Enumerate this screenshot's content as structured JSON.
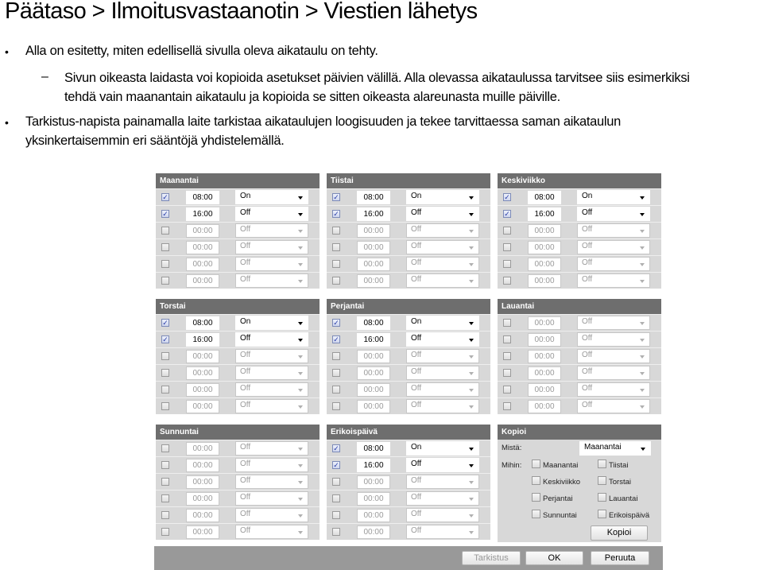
{
  "title": "Päätaso > Ilmoitusvastaanotin > Viestien lähetys",
  "bullets": [
    "Alla on esitetty, miten edellisellä sivulla oleva aikataulu on tehty.",
    "Sivun oikeasta laidasta voi kopioida asetukset päivien välillä. Alla olevassa aikataulussa tarvitsee siis esimerkiksi",
    "tehdä vain maanantain aikataulu ja kopioida se sitten oikeasta alareunasta muille päiville.",
    "Tarkistus-napista painamalla laite tarkistaa aikataulujen loogisuuden ja tekee tarvittaessa saman aikataulun",
    "yksinkertaisemmin eri sääntöjä yhdistelemällä."
  ],
  "panels": [
    {
      "name": "Maanantai",
      "rows": [
        {
          "checked": true,
          "time": "08:00",
          "state": "On"
        },
        {
          "checked": true,
          "time": "16:00",
          "state": "Off"
        },
        {
          "checked": false,
          "time": "00:00",
          "state": "Off"
        },
        {
          "checked": false,
          "time": "00:00",
          "state": "Off"
        },
        {
          "checked": false,
          "time": "00:00",
          "state": "Off"
        },
        {
          "checked": false,
          "time": "00:00",
          "state": "Off"
        }
      ]
    },
    {
      "name": "Tiistai",
      "rows": [
        {
          "checked": true,
          "time": "08:00",
          "state": "On"
        },
        {
          "checked": true,
          "time": "16:00",
          "state": "Off"
        },
        {
          "checked": false,
          "time": "00:00",
          "state": "Off"
        },
        {
          "checked": false,
          "time": "00:00",
          "state": "Off"
        },
        {
          "checked": false,
          "time": "00:00",
          "state": "Off"
        },
        {
          "checked": false,
          "time": "00:00",
          "state": "Off"
        }
      ]
    },
    {
      "name": "Keskiviikko",
      "rows": [
        {
          "checked": true,
          "time": "08:00",
          "state": "On"
        },
        {
          "checked": true,
          "time": "16:00",
          "state": "Off"
        },
        {
          "checked": false,
          "time": "00:00",
          "state": "Off"
        },
        {
          "checked": false,
          "time": "00:00",
          "state": "Off"
        },
        {
          "checked": false,
          "time": "00:00",
          "state": "Off"
        },
        {
          "checked": false,
          "time": "00:00",
          "state": "Off"
        }
      ]
    },
    {
      "name": "Torstai",
      "rows": [
        {
          "checked": true,
          "time": "08:00",
          "state": "On"
        },
        {
          "checked": true,
          "time": "16:00",
          "state": "Off"
        },
        {
          "checked": false,
          "time": "00:00",
          "state": "Off"
        },
        {
          "checked": false,
          "time": "00:00",
          "state": "Off"
        },
        {
          "checked": false,
          "time": "00:00",
          "state": "Off"
        },
        {
          "checked": false,
          "time": "00:00",
          "state": "Off"
        }
      ]
    },
    {
      "name": "Perjantai",
      "rows": [
        {
          "checked": true,
          "time": "08:00",
          "state": "On"
        },
        {
          "checked": true,
          "time": "16:00",
          "state": "Off"
        },
        {
          "checked": false,
          "time": "00:00",
          "state": "Off"
        },
        {
          "checked": false,
          "time": "00:00",
          "state": "Off"
        },
        {
          "checked": false,
          "time": "00:00",
          "state": "Off"
        },
        {
          "checked": false,
          "time": "00:00",
          "state": "Off"
        }
      ]
    },
    {
      "name": "Lauantai",
      "rows": [
        {
          "checked": false,
          "time": "00:00",
          "state": "Off"
        },
        {
          "checked": false,
          "time": "00:00",
          "state": "Off"
        },
        {
          "checked": false,
          "time": "00:00",
          "state": "Off"
        },
        {
          "checked": false,
          "time": "00:00",
          "state": "Off"
        },
        {
          "checked": false,
          "time": "00:00",
          "state": "Off"
        },
        {
          "checked": false,
          "time": "00:00",
          "state": "Off"
        }
      ]
    },
    {
      "name": "Sunnuntai",
      "rows": [
        {
          "checked": false,
          "time": "00:00",
          "state": "Off"
        },
        {
          "checked": false,
          "time": "00:00",
          "state": "Off"
        },
        {
          "checked": false,
          "time": "00:00",
          "state": "Off"
        },
        {
          "checked": false,
          "time": "00:00",
          "state": "Off"
        },
        {
          "checked": false,
          "time": "00:00",
          "state": "Off"
        },
        {
          "checked": false,
          "time": "00:00",
          "state": "Off"
        }
      ]
    },
    {
      "name": "Erikoispäivä",
      "rows": [
        {
          "checked": true,
          "time": "08:00",
          "state": "On"
        },
        {
          "checked": true,
          "time": "16:00",
          "state": "Off"
        },
        {
          "checked": false,
          "time": "00:00",
          "state": "Off"
        },
        {
          "checked": false,
          "time": "00:00",
          "state": "Off"
        },
        {
          "checked": false,
          "time": "00:00",
          "state": "Off"
        },
        {
          "checked": false,
          "time": "00:00",
          "state": "Off"
        }
      ]
    }
  ],
  "copy": {
    "title": "Kopioi",
    "from_label": "Mistä:",
    "from_value": "Maanantai",
    "to_label": "Mihin:",
    "targets": [
      "Maanantai",
      "Tiistai",
      "Keskiviikko",
      "Torstai",
      "Perjantai",
      "Lauantai",
      "Sunnuntai",
      "Erikoispäivä"
    ],
    "button": "Kopioi"
  },
  "footer": {
    "check_button": "Tarkistus",
    "ok_button": "OK",
    "cancel_button": "Peruuta"
  }
}
